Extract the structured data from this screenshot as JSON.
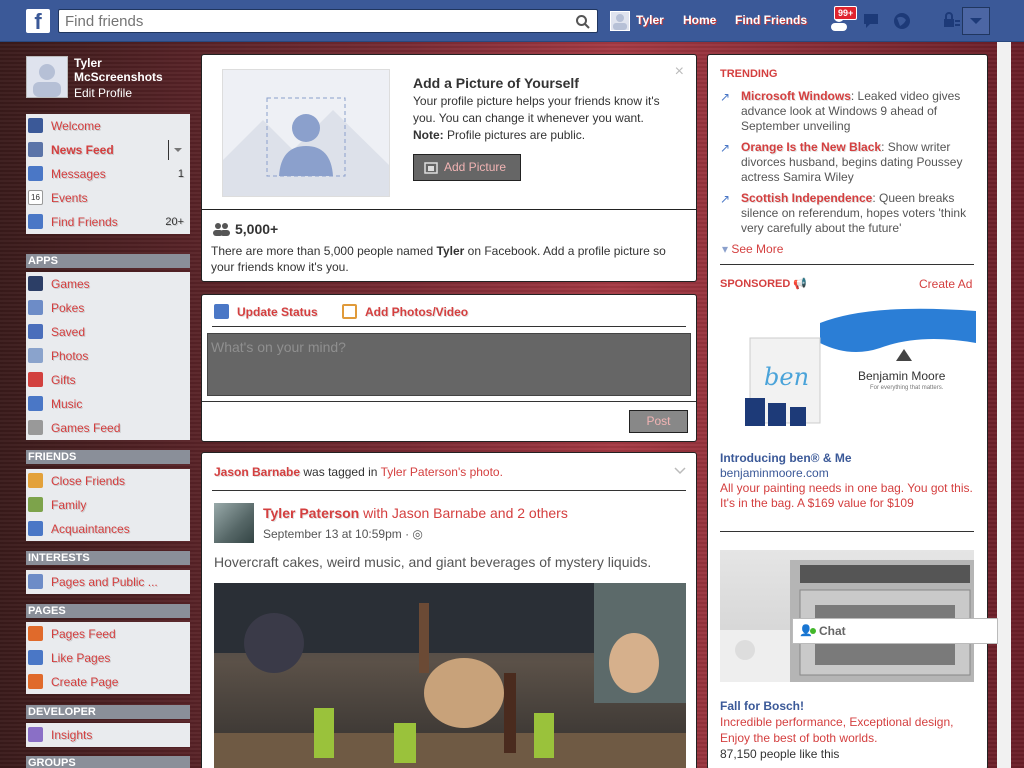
{
  "topbar": {
    "logo": "f",
    "search_placeholder": "Find friends",
    "user": "Tyler",
    "home": "Home",
    "find_friends": "Find Friends",
    "notif_count": "99+"
  },
  "profile": {
    "name": "Tyler McScreenshots",
    "edit": "Edit Profile"
  },
  "sidebar": {
    "main": [
      {
        "label": "Welcome",
        "icon": "facebook-icon",
        "count": ""
      },
      {
        "label": "News Feed",
        "icon": "news-feed-icon",
        "count": ""
      },
      {
        "label": "Messages",
        "icon": "messages-icon",
        "count": "1"
      },
      {
        "label": "Events",
        "icon": "events-icon",
        "count": ""
      },
      {
        "label": "Find Friends",
        "icon": "find-friends-icon",
        "count": "20+"
      }
    ],
    "events_day": "16",
    "apps_header": "APPS",
    "apps": [
      "Games",
      "Pokes",
      "Saved",
      "Photos",
      "Gifts",
      "Music",
      "Games Feed"
    ],
    "friends_header": "FRIENDS",
    "friends": [
      "Close Friends",
      "Family",
      "Acquaintances"
    ],
    "interests_header": "INTERESTS",
    "interests": [
      "Pages and Public ..."
    ],
    "pages_header": "PAGES",
    "pages": [
      "Pages Feed",
      "Like Pages",
      "Create Page"
    ],
    "developer_header": "DEVELOPER",
    "developer": [
      "Insights"
    ],
    "groups_header": "GROUPS"
  },
  "add_picture": {
    "title": "Add a Picture of Yourself",
    "desc": "Your profile picture helps your friends know it's you. You can change it whenever you want.",
    "note_label": "Note:",
    "note": "Profile pictures are public.",
    "button": "Add Picture",
    "count": "5,000+",
    "more_text_1": "There are more than 5,000 people named",
    "more_name": "Tyler",
    "more_text_2": "on Facebook. Add a profile picture so your friends know it's you."
  },
  "composer": {
    "update_status": "Update Status",
    "add_photos": "Add Photos/Video",
    "placeholder": "What's on your mind?",
    "post": "Post"
  },
  "story": {
    "tag_actor": "Jason Barnabe",
    "tag_text": "was tagged in",
    "tag_owner": "Tyler Paterson",
    "tag_suffix": "'s photo.",
    "author": "Tyler Paterson",
    "with": "with",
    "with_name": "Jason Barnabe",
    "and": "and",
    "others": "2 others",
    "date": "September 13 at 10:59pm · ",
    "text": "Hovercraft cakes, weird music, and giant beverages of mystery liquids."
  },
  "trending": {
    "header": "TRENDING",
    "items": [
      {
        "topic": "Microsoft Windows",
        "text": ": Leaked video gives advance look at Windows 9 ahead of September unveiling"
      },
      {
        "topic": "Orange Is the New Black",
        "text": ": Show writer divorces husband, begins dating Poussey actress Samira Wiley"
      },
      {
        "topic": "Scottish Independence",
        "text": ": Queen breaks silence on referendum, hopes voters 'think very carefully about the future'"
      }
    ],
    "see_more": "See More"
  },
  "sponsored": {
    "header": "SPONSORED",
    "create_ad": "Create Ad",
    "ad1": {
      "brand": "Benjamin Moore",
      "tagline": "For everything that matters.",
      "bag_text": "ben",
      "title": "Introducing ben® & Me",
      "url": "benjaminmoore.com",
      "text": "All your painting needs in one bag. You got this. It's in the bag. A $169 value for $109"
    },
    "ad2": {
      "title": "Fall for Bosch!",
      "text": "Incredible performance, Exceptional design, Enjoy the best of both worlds.",
      "likes": "87,150 people like this"
    }
  },
  "chat": {
    "label": "Chat"
  },
  "colors": {
    "fb_blue": "#3b5998",
    "accent_red": "#d43f3f"
  }
}
